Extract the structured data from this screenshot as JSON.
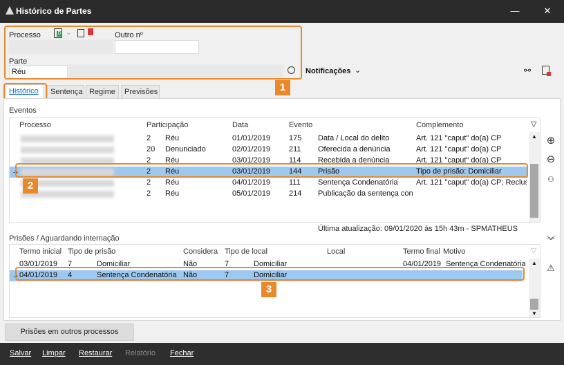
{
  "window": {
    "title": "Histórico de Partes",
    "minimize": "—",
    "close": "✕"
  },
  "header": {
    "processo_label": "Processo",
    "outro_label": "Outro nº",
    "parte_label": "Parte",
    "parte_tipo": "Réu",
    "notificacoes": "Notificações",
    "badge_1": "1"
  },
  "tabs": [
    {
      "label": "Histórico",
      "active": true
    },
    {
      "label": "Sentença",
      "active": false
    },
    {
      "label": "Regime",
      "active": false
    },
    {
      "label": "Previsões",
      "active": false
    }
  ],
  "eventos": {
    "title": "Eventos",
    "columns": [
      "Processo",
      "Participação",
      "Data",
      "Evento",
      "Complemento"
    ],
    "rows": [
      {
        "num": "2",
        "participacao": "Réu",
        "data": "01/01/2019",
        "cod": "175",
        "evento": "Data / Local do delito",
        "complemento": "Art. 121 \"caput\" do(a) CP",
        "selected": false
      },
      {
        "num": "20",
        "participacao": "Denunciado",
        "data": "02/01/2019",
        "cod": "211",
        "evento": "Oferecida a denúncia",
        "complemento": "Art. 121 \"caput\" do(a) CP",
        "selected": false
      },
      {
        "num": "2",
        "participacao": "Réu",
        "data": "03/01/2019",
        "cod": "114",
        "evento": "Recebida a denúncia",
        "complemento": "Art. 121 \"caput\" do(a) CP",
        "selected": false
      },
      {
        "num": "2",
        "participacao": "Réu",
        "data": "03/01/2019",
        "cod": "144",
        "evento": "Prisão",
        "complemento": "Tipo de prisão: Domiciliar",
        "selected": true
      },
      {
        "num": "2",
        "participacao": "Réu",
        "data": "04/01/2019",
        "cod": "111",
        "evento": "Sentença Condenatória",
        "complemento": "Art. 121 \"caput\" do(a) CP; Reclus",
        "selected": false
      },
      {
        "num": "2",
        "participacao": "Réu",
        "data": "05/01/2019",
        "cod": "214",
        "evento": "Publicação da sentença cond",
        "complemento": "",
        "selected": false
      }
    ],
    "badge_2": "2",
    "ultima_atualizacao": "Última atualização:  09/01/2020 às 15h 43m  -  SPMATHEUS"
  },
  "prisoes": {
    "title": "Prisões / Aguardando internação",
    "columns": [
      "Termo inicial",
      "Tipo de prisão",
      "Considera",
      "Tipo de local",
      "Local",
      "Termo final",
      "Motivo"
    ],
    "rows": [
      {
        "inicio": "03/01/2019",
        "tipo_cod": "7",
        "tipo": "Domiciliar",
        "considera": "Não",
        "local_cod": "7",
        "local_tipo": "Domiciliar",
        "final": "04/01/2019",
        "motivo": "Sentença Condenatória",
        "selected": false
      },
      {
        "inicio": "04/01/2019",
        "tipo_cod": "4",
        "tipo": "Sentença Condenatória",
        "considera": "Não",
        "local_cod": "7",
        "local_tipo": "Domiciliar",
        "final": "",
        "motivo": "",
        "selected": true
      }
    ],
    "badge_3": "3"
  },
  "bottom_button": "Prisões em outros processos",
  "footer": {
    "salvar": "Salvar",
    "limpar": "Limpar",
    "restaurar": "Restaurar",
    "relatorio": "Relatório",
    "fechar": "Fechar"
  },
  "colors": {
    "accent": "#e8892b",
    "selection": "#9dc8ef",
    "titlebar": "#2b2b2b"
  }
}
